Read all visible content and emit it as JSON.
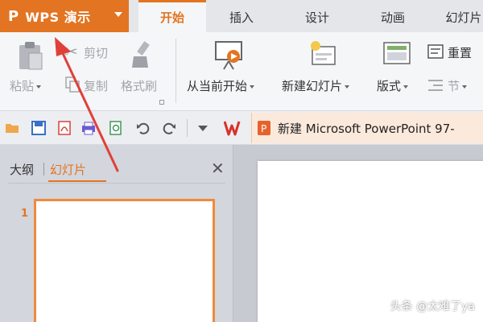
{
  "app": {
    "logo": "P",
    "name": "WPS 演示"
  },
  "tabs": [
    "开始",
    "插入",
    "设计",
    "动画",
    "幻灯片"
  ],
  "ribbon": {
    "paste": "粘贴",
    "cut": "剪切",
    "copy": "复制",
    "format_painter": "格式刷",
    "start_from_current": "从当前开始",
    "new_slide": "新建幻灯片",
    "layout": "版式",
    "reset": "重置",
    "section": "节"
  },
  "document": {
    "title": "新建 Microsoft PowerPoint 97-"
  },
  "panel": {
    "outline_tab": "大纲",
    "slides_tab": "幻灯片",
    "slide_number": "1"
  },
  "watermark": "头条 @太难了ya",
  "colors": {
    "accent": "#e37422",
    "annotation_arrow": "#e0403a"
  }
}
